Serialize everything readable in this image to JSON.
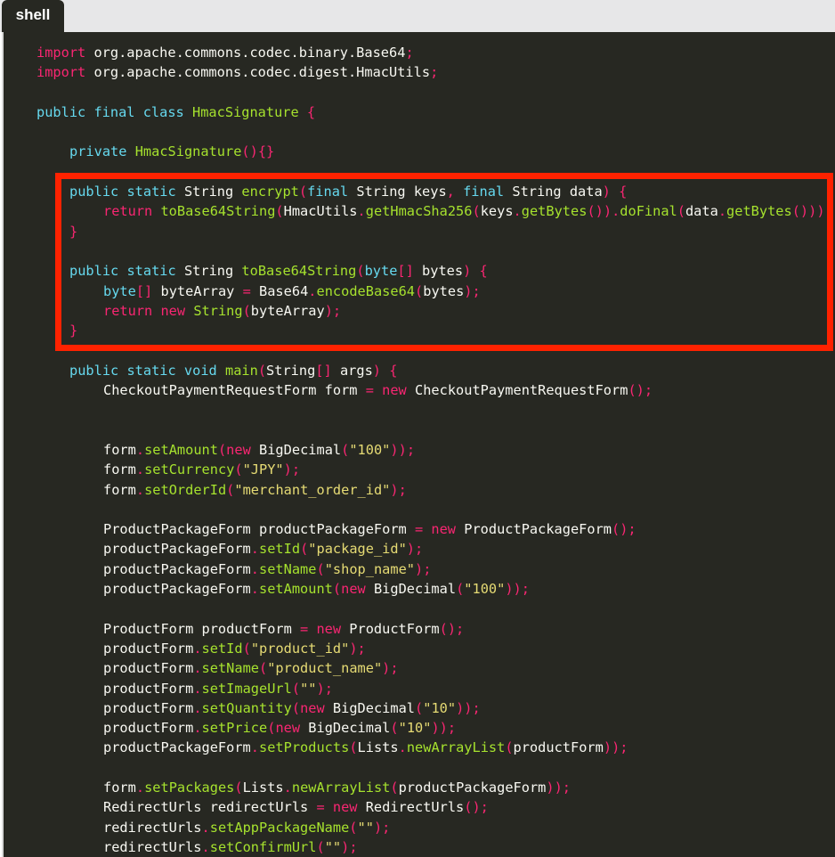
{
  "tab": {
    "label": "shell"
  },
  "annotation": {
    "color": "#ff2200",
    "kind": "red-rectangle-highlight"
  },
  "theme": {
    "background": "#272822",
    "keyword": "#f92672",
    "type": "#66d9ef",
    "function": "#a6e22e",
    "string": "#e6db74",
    "text": "#f8f8f2"
  },
  "code": {
    "lines": [
      {
        "indent": 1,
        "tokens": [
          [
            "kw",
            "import "
          ],
          [
            "tx",
            "org.apache.commons.codec.binary.Base64"
          ],
          [
            "pn",
            ";"
          ]
        ]
      },
      {
        "indent": 1,
        "tokens": [
          [
            "kw",
            "import "
          ],
          [
            "tx",
            "org.apache.commons.codec.digest.HmacUtils"
          ],
          [
            "pn",
            ";"
          ]
        ]
      },
      {
        "indent": 0,
        "tokens": []
      },
      {
        "indent": 1,
        "tokens": [
          [
            "st",
            "public final class "
          ],
          [
            "cls",
            "HmacSignature "
          ],
          [
            "pn",
            "{"
          ]
        ]
      },
      {
        "indent": 0,
        "tokens": []
      },
      {
        "indent": 2,
        "tokens": [
          [
            "st",
            "private "
          ],
          [
            "cls",
            "HmacSignature"
          ],
          [
            "pn",
            "(){}"
          ]
        ]
      },
      {
        "indent": 0,
        "tokens": []
      },
      {
        "indent": 2,
        "tokens": [
          [
            "st",
            "public static "
          ],
          [
            "tx",
            "String "
          ],
          [
            "fn",
            "encrypt"
          ],
          [
            "pn",
            "("
          ],
          [
            "st",
            "final "
          ],
          [
            "tx",
            "String keys"
          ],
          [
            "pn",
            ", "
          ],
          [
            "st",
            "final "
          ],
          [
            "tx",
            "String data"
          ],
          [
            "pn",
            ") {"
          ]
        ]
      },
      {
        "indent": 3,
        "tokens": [
          [
            "kw",
            "return "
          ],
          [
            "fn",
            "toBase64String"
          ],
          [
            "pn",
            "("
          ],
          [
            "tx",
            "HmacUtils"
          ],
          [
            "pn",
            "."
          ],
          [
            "fn",
            "getHmacSha256"
          ],
          [
            "pn",
            "("
          ],
          [
            "tx",
            "keys"
          ],
          [
            "pn",
            "."
          ],
          [
            "fn",
            "getBytes"
          ],
          [
            "pn",
            "())."
          ],
          [
            "fn",
            "doFinal"
          ],
          [
            "pn",
            "("
          ],
          [
            "tx",
            "data"
          ],
          [
            "pn",
            "."
          ],
          [
            "fn",
            "getBytes"
          ],
          [
            "pn",
            "()))"
          ]
        ]
      },
      {
        "indent": 2,
        "tokens": [
          [
            "pn",
            "}"
          ]
        ]
      },
      {
        "indent": 0,
        "tokens": []
      },
      {
        "indent": 2,
        "tokens": [
          [
            "st",
            "public static "
          ],
          [
            "tx",
            "String "
          ],
          [
            "fn",
            "toBase64String"
          ],
          [
            "pn",
            "("
          ],
          [
            "st",
            "byte"
          ],
          [
            "pn",
            "[] "
          ],
          [
            "tx",
            "bytes"
          ],
          [
            "pn",
            ") {"
          ]
        ]
      },
      {
        "indent": 3,
        "tokens": [
          [
            "st",
            "byte"
          ],
          [
            "pn",
            "[] "
          ],
          [
            "tx",
            "byteArray "
          ],
          [
            "pn",
            "= "
          ],
          [
            "tx",
            "Base64"
          ],
          [
            "pn",
            "."
          ],
          [
            "fn",
            "encodeBase64"
          ],
          [
            "pn",
            "("
          ],
          [
            "tx",
            "bytes"
          ],
          [
            "pn",
            ");"
          ]
        ]
      },
      {
        "indent": 3,
        "tokens": [
          [
            "kw",
            "return "
          ],
          [
            "kw",
            "new "
          ],
          [
            "cls",
            "String"
          ],
          [
            "pn",
            "("
          ],
          [
            "tx",
            "byteArray"
          ],
          [
            "pn",
            ");"
          ]
        ]
      },
      {
        "indent": 2,
        "tokens": [
          [
            "pn",
            "}"
          ]
        ]
      },
      {
        "indent": 0,
        "tokens": []
      },
      {
        "indent": 2,
        "tokens": [
          [
            "st",
            "public static void "
          ],
          [
            "fn",
            "main"
          ],
          [
            "pn",
            "("
          ],
          [
            "tx",
            "String"
          ],
          [
            "pn",
            "[] "
          ],
          [
            "tx",
            "args"
          ],
          [
            "pn",
            ") {"
          ]
        ]
      },
      {
        "indent": 3,
        "tokens": [
          [
            "tx",
            "CheckoutPaymentRequestForm form "
          ],
          [
            "pn",
            "= "
          ],
          [
            "kw",
            "new "
          ],
          [
            "tx",
            "CheckoutPaymentRequestForm"
          ],
          [
            "pn",
            "();"
          ]
        ]
      },
      {
        "indent": 0,
        "tokens": []
      },
      {
        "indent": 0,
        "tokens": []
      },
      {
        "indent": 3,
        "tokens": [
          [
            "tx",
            "form"
          ],
          [
            "pn",
            "."
          ],
          [
            "fn",
            "setAmount"
          ],
          [
            "pn",
            "("
          ],
          [
            "kw",
            "new "
          ],
          [
            "tx",
            "BigDecimal"
          ],
          [
            "pn",
            "("
          ],
          [
            "str",
            "\"100\""
          ],
          [
            "pn",
            "));"
          ]
        ]
      },
      {
        "indent": 3,
        "tokens": [
          [
            "tx",
            "form"
          ],
          [
            "pn",
            "."
          ],
          [
            "fn",
            "setCurrency"
          ],
          [
            "pn",
            "("
          ],
          [
            "str",
            "\"JPY\""
          ],
          [
            "pn",
            ");"
          ]
        ]
      },
      {
        "indent": 3,
        "tokens": [
          [
            "tx",
            "form"
          ],
          [
            "pn",
            "."
          ],
          [
            "fn",
            "setOrderId"
          ],
          [
            "pn",
            "("
          ],
          [
            "str",
            "\"merchant_order_id\""
          ],
          [
            "pn",
            ");"
          ]
        ]
      },
      {
        "indent": 0,
        "tokens": []
      },
      {
        "indent": 3,
        "tokens": [
          [
            "tx",
            "ProductPackageForm productPackageForm "
          ],
          [
            "pn",
            "= "
          ],
          [
            "kw",
            "new "
          ],
          [
            "tx",
            "ProductPackageForm"
          ],
          [
            "pn",
            "();"
          ]
        ]
      },
      {
        "indent": 3,
        "tokens": [
          [
            "tx",
            "productPackageForm"
          ],
          [
            "pn",
            "."
          ],
          [
            "fn",
            "setId"
          ],
          [
            "pn",
            "("
          ],
          [
            "str",
            "\"package_id\""
          ],
          [
            "pn",
            ");"
          ]
        ]
      },
      {
        "indent": 3,
        "tokens": [
          [
            "tx",
            "productPackageForm"
          ],
          [
            "pn",
            "."
          ],
          [
            "fn",
            "setName"
          ],
          [
            "pn",
            "("
          ],
          [
            "str",
            "\"shop_name\""
          ],
          [
            "pn",
            ");"
          ]
        ]
      },
      {
        "indent": 3,
        "tokens": [
          [
            "tx",
            "productPackageForm"
          ],
          [
            "pn",
            "."
          ],
          [
            "fn",
            "setAmount"
          ],
          [
            "pn",
            "("
          ],
          [
            "kw",
            "new "
          ],
          [
            "tx",
            "BigDecimal"
          ],
          [
            "pn",
            "("
          ],
          [
            "str",
            "\"100\""
          ],
          [
            "pn",
            "));"
          ]
        ]
      },
      {
        "indent": 0,
        "tokens": []
      },
      {
        "indent": 3,
        "tokens": [
          [
            "tx",
            "ProductForm productForm "
          ],
          [
            "pn",
            "= "
          ],
          [
            "kw",
            "new "
          ],
          [
            "tx",
            "ProductForm"
          ],
          [
            "pn",
            "();"
          ]
        ]
      },
      {
        "indent": 3,
        "tokens": [
          [
            "tx",
            "productForm"
          ],
          [
            "pn",
            "."
          ],
          [
            "fn",
            "setId"
          ],
          [
            "pn",
            "("
          ],
          [
            "str",
            "\"product_id\""
          ],
          [
            "pn",
            ");"
          ]
        ]
      },
      {
        "indent": 3,
        "tokens": [
          [
            "tx",
            "productForm"
          ],
          [
            "pn",
            "."
          ],
          [
            "fn",
            "setName"
          ],
          [
            "pn",
            "("
          ],
          [
            "str",
            "\"product_name\""
          ],
          [
            "pn",
            ");"
          ]
        ]
      },
      {
        "indent": 3,
        "tokens": [
          [
            "tx",
            "productForm"
          ],
          [
            "pn",
            "."
          ],
          [
            "fn",
            "setImageUrl"
          ],
          [
            "pn",
            "("
          ],
          [
            "str",
            "\"\""
          ],
          [
            "pn",
            ");"
          ]
        ]
      },
      {
        "indent": 3,
        "tokens": [
          [
            "tx",
            "productForm"
          ],
          [
            "pn",
            "."
          ],
          [
            "fn",
            "setQuantity"
          ],
          [
            "pn",
            "("
          ],
          [
            "kw",
            "new "
          ],
          [
            "tx",
            "BigDecimal"
          ],
          [
            "pn",
            "("
          ],
          [
            "str",
            "\"10\""
          ],
          [
            "pn",
            "));"
          ]
        ]
      },
      {
        "indent": 3,
        "tokens": [
          [
            "tx",
            "productForm"
          ],
          [
            "pn",
            "."
          ],
          [
            "fn",
            "setPrice"
          ],
          [
            "pn",
            "("
          ],
          [
            "kw",
            "new "
          ],
          [
            "tx",
            "BigDecimal"
          ],
          [
            "pn",
            "("
          ],
          [
            "str",
            "\"10\""
          ],
          [
            "pn",
            "));"
          ]
        ]
      },
      {
        "indent": 3,
        "tokens": [
          [
            "tx",
            "productPackageForm"
          ],
          [
            "pn",
            "."
          ],
          [
            "fn",
            "setProducts"
          ],
          [
            "pn",
            "("
          ],
          [
            "tx",
            "Lists"
          ],
          [
            "pn",
            "."
          ],
          [
            "fn",
            "newArrayList"
          ],
          [
            "pn",
            "("
          ],
          [
            "tx",
            "productForm"
          ],
          [
            "pn",
            "));"
          ]
        ]
      },
      {
        "indent": 0,
        "tokens": []
      },
      {
        "indent": 3,
        "tokens": [
          [
            "tx",
            "form"
          ],
          [
            "pn",
            "."
          ],
          [
            "fn",
            "setPackages"
          ],
          [
            "pn",
            "("
          ],
          [
            "tx",
            "Lists"
          ],
          [
            "pn",
            "."
          ],
          [
            "fn",
            "newArrayList"
          ],
          [
            "pn",
            "("
          ],
          [
            "tx",
            "productPackageForm"
          ],
          [
            "pn",
            "));"
          ]
        ]
      },
      {
        "indent": 3,
        "tokens": [
          [
            "tx",
            "RedirectUrls redirectUrls "
          ],
          [
            "pn",
            "= "
          ],
          [
            "kw",
            "new "
          ],
          [
            "tx",
            "RedirectUrls"
          ],
          [
            "pn",
            "();"
          ]
        ]
      },
      {
        "indent": 3,
        "tokens": [
          [
            "tx",
            "redirectUrls"
          ],
          [
            "pn",
            "."
          ],
          [
            "fn",
            "setAppPackageName"
          ],
          [
            "pn",
            "("
          ],
          [
            "str",
            "\"\""
          ],
          [
            "pn",
            ");"
          ]
        ]
      },
      {
        "indent": 3,
        "tokens": [
          [
            "tx",
            "redirectUrls"
          ],
          [
            "pn",
            "."
          ],
          [
            "fn",
            "setConfirmUrl"
          ],
          [
            "pn",
            "("
          ],
          [
            "str",
            "\"\""
          ],
          [
            "pn",
            ");"
          ]
        ]
      }
    ]
  }
}
